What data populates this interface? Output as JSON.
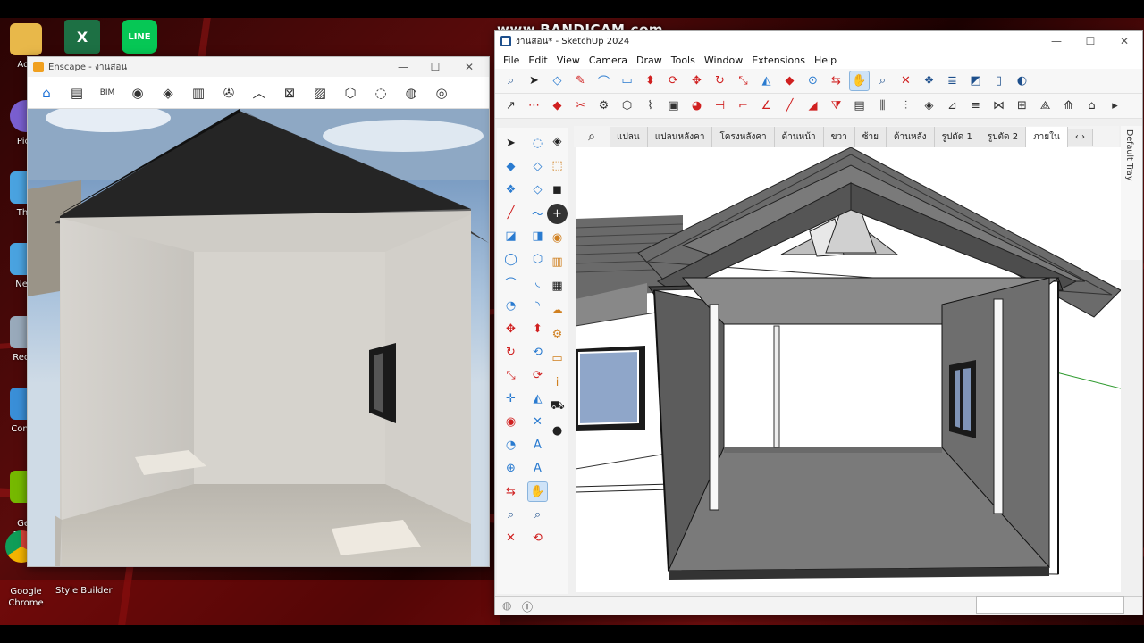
{
  "recording": {
    "watermark": "www.BANDICAM.com"
  },
  "desktop": {
    "icons": [
      {
        "label": "Ado",
        "icon": "user-folder-icon",
        "color": "#e8b84a"
      },
      {
        "label": "Pica",
        "icon": "picasa-icon",
        "color": "#7a5fd0"
      },
      {
        "label": "This",
        "icon": "this-pc-icon",
        "color": "#4aa3e0"
      },
      {
        "label": "Netv",
        "icon": "network-icon",
        "color": "#4aa3e0"
      },
      {
        "label": "Recyc",
        "icon": "recycle-bin-icon",
        "color": "#9ab"
      },
      {
        "label": "Contro",
        "icon": "control-panel-icon",
        "color": "#3a8fd8"
      },
      {
        "label": "GeF\nExper",
        "icon": "geforce-experience-icon",
        "color": "#76b900"
      }
    ],
    "taskbar_icons": [
      {
        "label": "",
        "icon": "excel-icon",
        "color": "#1d7044"
      },
      {
        "label": "",
        "icon": "line-icon",
        "color": "#06c755",
        "text": "LINE"
      }
    ],
    "chrome_label": "Google Chrome",
    "style_builder_label": "Style Builder"
  },
  "enscape": {
    "title": "Enscape - งานสอน",
    "toolbar": [
      {
        "name": "home-icon",
        "glyph": "⌂",
        "active": true
      },
      {
        "name": "document-icon",
        "glyph": "▤",
        "active": false
      },
      {
        "name": "bim-icon",
        "glyph": "BIM",
        "active": false
      },
      {
        "name": "eye-view-icon",
        "glyph": "◉",
        "active": false
      },
      {
        "name": "compass-icon",
        "glyph": "◈",
        "active": false
      },
      {
        "name": "building-icon",
        "glyph": "▥",
        "active": false
      },
      {
        "name": "film-reel-icon",
        "glyph": "✇",
        "active": false
      },
      {
        "name": "collapse-chevron-icon",
        "glyph": "︿",
        "active": false
      },
      {
        "name": "map-pin-icon",
        "glyph": "⊠",
        "active": false
      },
      {
        "name": "image-icon",
        "glyph": "▨",
        "active": false
      },
      {
        "name": "cube-icon",
        "glyph": "⬡",
        "active": false
      },
      {
        "name": "material-icon",
        "glyph": "◌",
        "active": false
      },
      {
        "name": "vr-headset-icon",
        "glyph": "◍",
        "active": false
      },
      {
        "name": "visibility-icon",
        "glyph": "◎",
        "active": false
      }
    ]
  },
  "sketchup": {
    "title": "งานสอน* - SketchUp 2024",
    "menu": [
      "File",
      "Edit",
      "View",
      "Camera",
      "Draw",
      "Tools",
      "Window",
      "Extensions",
      "Help"
    ],
    "scene_tabs": [
      "แปลน",
      "แปลนหลังคา",
      "โครงหลังคา",
      "ด้านหน้า",
      "ขวา",
      "ซ้าย",
      "ด้านหลัง",
      "รูปตัด 1",
      "รูปตัด 2",
      "ภายใน"
    ],
    "active_tab": "ภายใน",
    "tray_label": "Default Tray",
    "toolbar1": [
      {
        "name": "search-icon",
        "glyph": "⌕",
        "color": "#1d4f8c"
      },
      {
        "name": "select-arrow-icon",
        "glyph": "➤",
        "color": "#222"
      },
      {
        "name": "eraser-icon",
        "glyph": "◇",
        "color": "#2a7bd0"
      },
      {
        "name": "pencil-icon",
        "glyph": "✎",
        "color": "#d02020"
      },
      {
        "name": "arc-icon",
        "glyph": "⌒",
        "color": "#2a7bd0"
      },
      {
        "name": "rectangle-icon",
        "glyph": "▭",
        "color": "#2a7bd0"
      },
      {
        "name": "push-pull-icon",
        "glyph": "⬍",
        "color": "#d02020"
      },
      {
        "name": "orbit-icon",
        "glyph": "⟳",
        "color": "#d02020"
      },
      {
        "name": "move-icon",
        "glyph": "✥",
        "color": "#d02020"
      },
      {
        "name": "rotate-icon",
        "glyph": "↻",
        "color": "#d02020"
      },
      {
        "name": "scale-icon",
        "glyph": "⤡",
        "color": "#d02020"
      },
      {
        "name": "section-icon",
        "glyph": "◭",
        "color": "#2a7bd0"
      },
      {
        "name": "paint-bucket-icon",
        "glyph": "◆",
        "color": "#d02020"
      },
      {
        "name": "tape-measure-icon",
        "glyph": "⊙",
        "color": "#2a7bd0"
      },
      {
        "name": "walk-icon",
        "glyph": "⇆",
        "color": "#d02020"
      },
      {
        "name": "pan-hand-icon",
        "glyph": "✋",
        "color": "#d02020"
      },
      {
        "name": "zoom-icon",
        "glyph": "⌕",
        "color": "#1d4f8c"
      },
      {
        "name": "zoom-extents-icon",
        "glyph": "✕",
        "color": "#d02020"
      },
      {
        "name": "components-icon",
        "glyph": "❖",
        "color": "#1d4f8c"
      },
      {
        "name": "layers-icon",
        "glyph": "≣",
        "color": "#1d4f8c"
      },
      {
        "name": "styles-icon",
        "glyph": "◩",
        "color": "#1d4f8c"
      },
      {
        "name": "page-icon",
        "glyph": "▯",
        "color": "#1d4f8c"
      },
      {
        "name": "shadow-icon",
        "glyph": "◐",
        "color": "#1d4f8c"
      }
    ],
    "toolbar2": [
      {
        "name": "follow-me-icon",
        "glyph": "↗",
        "color": "#333"
      },
      {
        "name": "polyline-icon",
        "glyph": "⋯",
        "color": "#d02020"
      },
      {
        "name": "extrude-icon",
        "glyph": "◆",
        "color": "#d02020"
      },
      {
        "name": "intersect-icon",
        "glyph": "✂",
        "color": "#d02020"
      },
      {
        "name": "gear-icon",
        "glyph": "⚙",
        "color": "#333"
      },
      {
        "name": "solid-icon",
        "glyph": "⬡",
        "color": "#333"
      },
      {
        "name": "bend-icon",
        "glyph": "⌇",
        "color": "#333"
      },
      {
        "name": "box-icon",
        "glyph": "▣",
        "color": "#333"
      },
      {
        "name": "shell-icon",
        "glyph": "◕",
        "color": "#d02020"
      },
      {
        "name": "split-icon",
        "glyph": "⊣",
        "color": "#d02020"
      },
      {
        "name": "corner-icon",
        "glyph": "⌐",
        "color": "#d02020"
      },
      {
        "name": "angle-icon",
        "glyph": "∠",
        "color": "#d02020"
      },
      {
        "name": "line-tool-icon",
        "glyph": "╱",
        "color": "#d02020"
      },
      {
        "name": "profile-icon",
        "glyph": "◢",
        "color": "#d02020"
      },
      {
        "name": "mirror-icon",
        "glyph": "⧩",
        "color": "#d02020"
      },
      {
        "name": "stair-icon",
        "glyph": "▤",
        "color": "#333"
      },
      {
        "name": "fence-icon",
        "glyph": "⫼",
        "color": "#333"
      },
      {
        "name": "array-icon",
        "glyph": "⫶",
        "color": "#333"
      },
      {
        "name": "stamp-icon",
        "glyph": "◈",
        "color": "#333"
      },
      {
        "name": "cut-icon",
        "glyph": "⊿",
        "color": "#333"
      },
      {
        "name": "rafter-icon",
        "glyph": "≡",
        "color": "#333"
      },
      {
        "name": "joist-icon",
        "glyph": "⋈",
        "color": "#333"
      },
      {
        "name": "frame-icon",
        "glyph": "⊞",
        "color": "#333"
      },
      {
        "name": "truss-icon",
        "glyph": "⟁",
        "color": "#333"
      },
      {
        "name": "beam-icon",
        "glyph": "⟰",
        "color": "#333"
      },
      {
        "name": "roof-icon",
        "glyph": "⌂",
        "color": "#333"
      },
      {
        "name": "expand-icon",
        "glyph": "▸",
        "color": "#333"
      }
    ],
    "left_tools": [
      {
        "name": "select-icon",
        "glyph": "➤",
        "color": "#222"
      },
      {
        "name": "lasso-icon",
        "glyph": "◌",
        "color": "#2a7bd0"
      },
      {
        "name": "paint-icon",
        "glyph": "◆",
        "color": "#2a7bd0"
      },
      {
        "name": "eraser-tool-icon",
        "glyph": "◇",
        "color": "#2a7bd0"
      },
      {
        "name": "components-tool-icon",
        "glyph": "❖",
        "color": "#2a7bd0"
      },
      {
        "name": "tag-icon",
        "glyph": "◇",
        "color": "#2a7bd0"
      },
      {
        "name": "line-icon",
        "glyph": "╱",
        "color": "#d02020"
      },
      {
        "name": "freehand-icon",
        "glyph": "〜",
        "color": "#2a7bd0"
      },
      {
        "name": "rectangle-tool-icon",
        "glyph": "◪",
        "color": "#2a7bd0"
      },
      {
        "name": "rotated-rect-icon",
        "glyph": "◨",
        "color": "#2a7bd0"
      },
      {
        "name": "circle-icon",
        "glyph": "◯",
        "color": "#2a7bd0"
      },
      {
        "name": "polygon-icon",
        "glyph": "⬡",
        "color": "#2a7bd0"
      },
      {
        "name": "arc-tool-icon",
        "glyph": "⌒",
        "color": "#2a7bd0"
      },
      {
        "name": "arc2-icon",
        "glyph": "◟",
        "color": "#2a7bd0"
      },
      {
        "name": "pie-icon",
        "glyph": "◔",
        "color": "#2a7bd0"
      },
      {
        "name": "arc3-icon",
        "glyph": "◝",
        "color": "#2a7bd0"
      },
      {
        "name": "move-tool-icon",
        "glyph": "✥",
        "color": "#d02020"
      },
      {
        "name": "push-pull-tool-icon",
        "glyph": "⬍",
        "color": "#d02020"
      },
      {
        "name": "rotate-tool-icon",
        "glyph": "↻",
        "color": "#d02020"
      },
      {
        "name": "follow-icon",
        "glyph": "⟲",
        "color": "#2a7bd0"
      },
      {
        "name": "scale-tool-icon",
        "glyph": "⤡",
        "color": "#d02020"
      },
      {
        "name": "offset-icon",
        "glyph": "⟳",
        "color": "#d02020"
      },
      {
        "name": "axes-icon",
        "glyph": "✛",
        "color": "#2a7bd0"
      },
      {
        "name": "protractor-icon",
        "glyph": "◭",
        "color": "#2a7bd0"
      },
      {
        "name": "section-tool-icon",
        "glyph": "◉",
        "color": "#d02020"
      },
      {
        "name": "dimension-icon",
        "glyph": "✕",
        "color": "#2a7bd0"
      },
      {
        "name": "tape-icon",
        "glyph": "◔",
        "color": "#2a7bd0"
      },
      {
        "name": "text-icon",
        "glyph": "A",
        "color": "#2a7bd0"
      },
      {
        "name": "axes2-icon",
        "glyph": "⊕",
        "color": "#2a7bd0"
      },
      {
        "name": "3d-text-icon",
        "glyph": "A",
        "color": "#2a7bd0"
      },
      {
        "name": "walk-tool-icon",
        "glyph": "⇆",
        "color": "#d02020"
      },
      {
        "name": "pan-tool-icon",
        "glyph": "✋",
        "color": "#d02020"
      },
      {
        "name": "zoom-tool-icon",
        "glyph": "⌕",
        "color": "#1d4f8c"
      },
      {
        "name": "zoom-window-icon",
        "glyph": "⌕",
        "color": "#1d4f8c"
      },
      {
        "name": "zoom-extents-tool-icon",
        "glyph": "✕",
        "color": "#d02020"
      },
      {
        "name": "previous-view-icon",
        "glyph": "⟲",
        "color": "#d02020"
      }
    ],
    "right_panel_tools": [
      {
        "name": "3d-warehouse-icon",
        "glyph": "◈",
        "color": "#222"
      },
      {
        "name": "extension-warehouse-icon",
        "glyph": "⬚",
        "color": "#d08020"
      },
      {
        "name": "camera-icon",
        "glyph": "◼",
        "color": "#222"
      },
      {
        "name": "add-icon",
        "glyph": "+",
        "color": "#fff"
      },
      {
        "name": "location-icon",
        "glyph": "◉",
        "color": "#d08020"
      },
      {
        "name": "library-icon",
        "glyph": "▥",
        "color": "#d08020"
      },
      {
        "name": "checker-icon",
        "glyph": "▦",
        "color": "#222"
      },
      {
        "name": "cloud-icon",
        "glyph": "☁",
        "color": "#d08020"
      },
      {
        "name": "settings-icon",
        "glyph": "⚙",
        "color": "#d08020"
      },
      {
        "name": "message-icon",
        "glyph": "▭",
        "color": "#d08020"
      },
      {
        "name": "info-icon",
        "glyph": "i",
        "color": "#d08020"
      },
      {
        "name": "cart-icon",
        "glyph": "⛟",
        "color": "#222"
      },
      {
        "name": "account-icon",
        "glyph": "●",
        "color": "#222"
      }
    ]
  }
}
